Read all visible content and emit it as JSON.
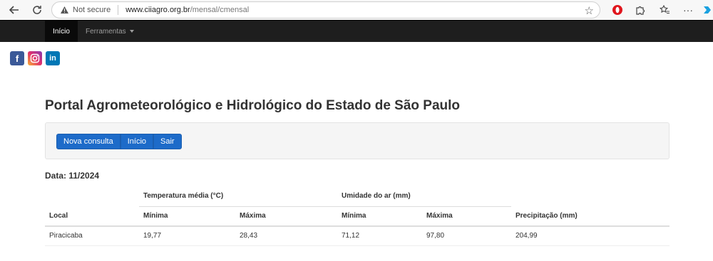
{
  "browser": {
    "security_label": "Not secure",
    "url_host": "www.ciiagro.org.br",
    "url_path": "/mensal/cmensal"
  },
  "navbar": {
    "home": "Início",
    "tools": "Ferramentas"
  },
  "social": {
    "facebook": "f",
    "linkedin": "in"
  },
  "page": {
    "title": "Portal Agrometeorológico e Hidrológico do Estado de São Paulo",
    "buttons": {
      "new_query": "Nova consulta",
      "home": "Início",
      "exit": "Sair"
    },
    "date_label": "Data: 11/2024"
  },
  "table": {
    "group_temp": "Temperatura média (°C)",
    "group_humidity": "Umidade do ar (mm)",
    "col_local": "Local",
    "col_temp_min": "Mínima",
    "col_temp_max": "Máxima",
    "col_hum_min": "Mínima",
    "col_hum_max": "Máxima",
    "col_precip": "Precipitação (mm)",
    "rows": [
      {
        "local": "Piracicaba",
        "temp_min": "19,77",
        "temp_max": "28,43",
        "hum_min": "71,12",
        "hum_max": "97,80",
        "precip": "204,99"
      }
    ]
  },
  "colors": {
    "navbar_bg": "#1e1e1e",
    "button_primary": "#1d6bc9",
    "well_bg": "#f5f5f5"
  }
}
